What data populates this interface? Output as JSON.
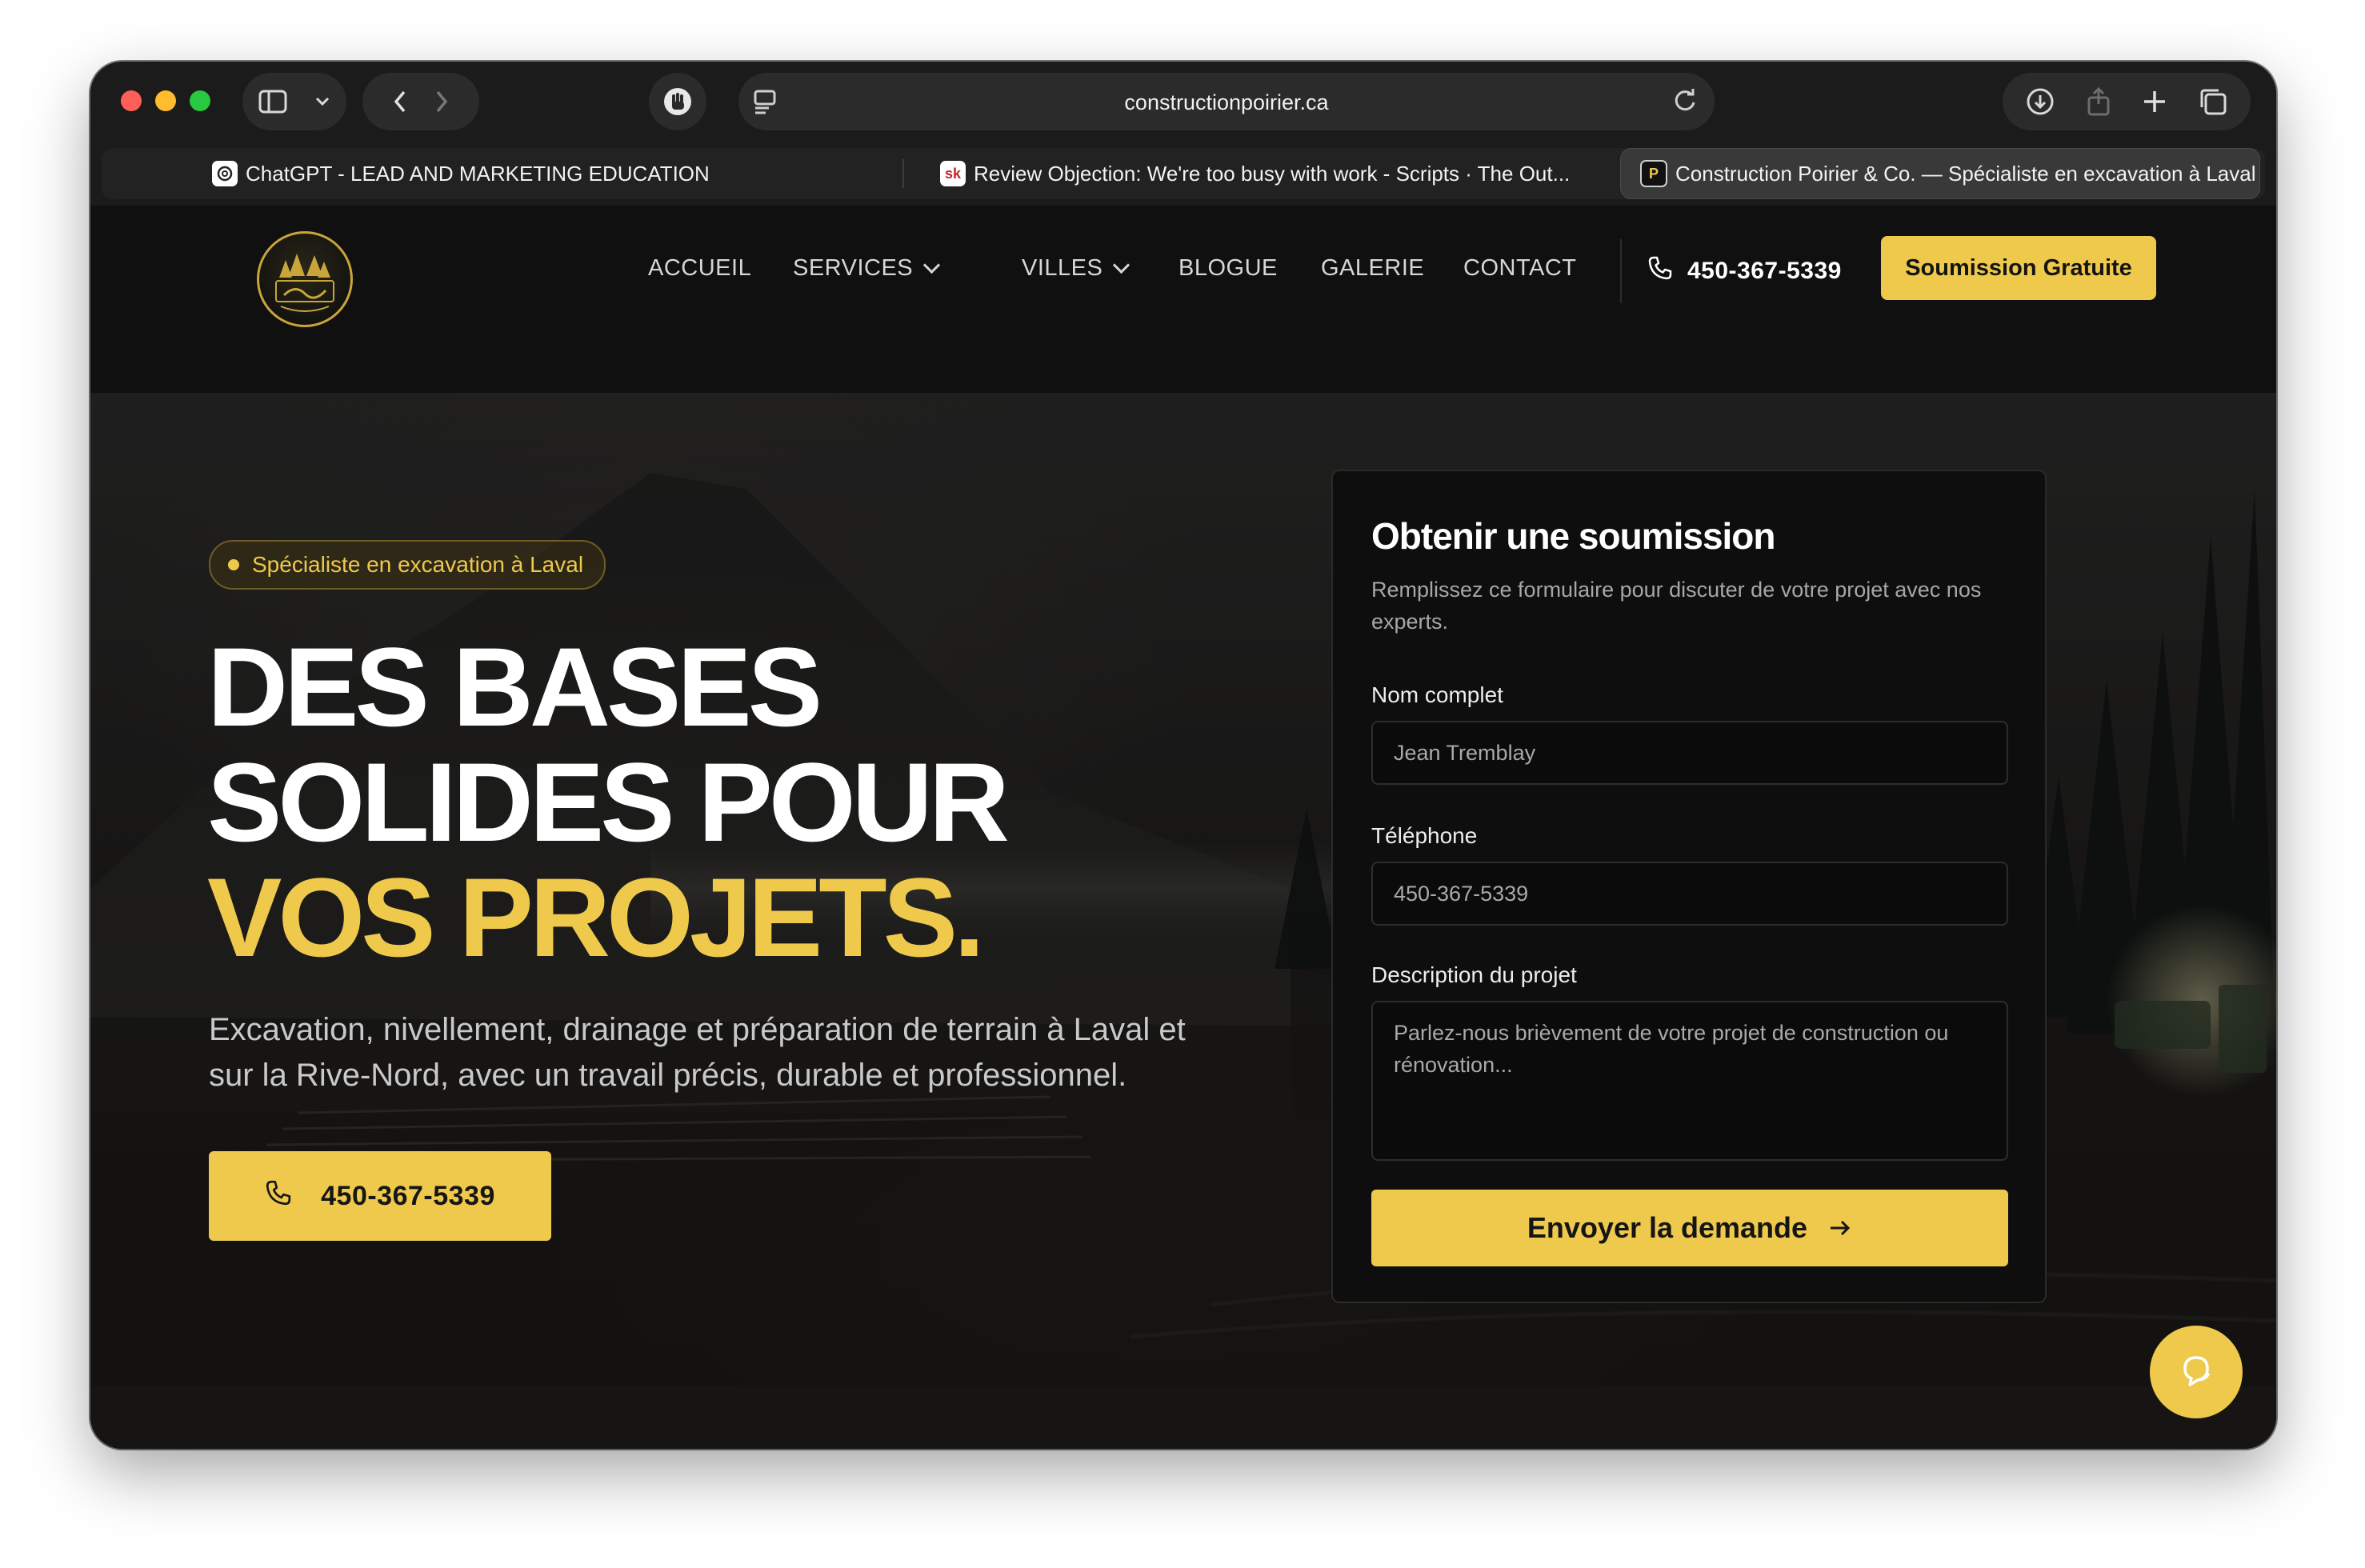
{
  "browser": {
    "url": "constructionpoirier.ca",
    "tabs": [
      {
        "title": "ChatGPT - LEAD AND MARKETING EDUCATION",
        "favicon": "openai-icon"
      },
      {
        "title": "Review Objection: We're too busy with work - Scripts · The Out...",
        "favicon_text": "sk"
      },
      {
        "title": "Construction Poirier & Co. — Spécialiste en excavation à Laval",
        "favicon_text": "P",
        "active": true
      }
    ]
  },
  "header": {
    "nav": [
      "ACCUEIL",
      "SERVICES",
      "VILLES",
      "BLOGUE",
      "GALERIE",
      "CONTACT"
    ],
    "phone": "450-367-5339",
    "cta": "Soumission Gratuite"
  },
  "hero": {
    "badge": "Spécialiste en excavation à Laval",
    "headline_1": "DES BASES",
    "headline_2": "SOLIDES POUR",
    "headline_3": "VOS PROJETS.",
    "subtext": "Excavation, nivellement, drainage et préparation de terrain à Laval et sur la Rive-Nord, avec un travail précis, durable et professionnel.",
    "cta_phone": "450-367-5339"
  },
  "form": {
    "title": "Obtenir une soumission",
    "description": "Remplissez ce formulaire pour discuter de votre projet avec nos experts.",
    "name_label": "Nom complet",
    "name_placeholder": "Jean Tremblay",
    "phone_label": "Téléphone",
    "phone_placeholder": "450-367-5339",
    "desc_label": "Description du projet",
    "desc_placeholder": "Parlez-nous brièvement de votre projet de construction ou rénovation...",
    "submit": "Envoyer la demande"
  },
  "colors": {
    "accent": "#efc94c",
    "background": "#121110",
    "card": "#0e0e0e"
  }
}
